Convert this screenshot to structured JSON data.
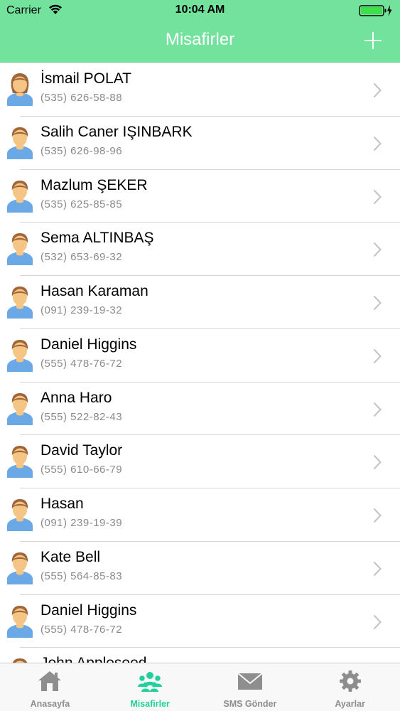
{
  "status_bar": {
    "carrier": "Carrier",
    "time": "10:04 AM",
    "wifi_icon": "wifi-icon",
    "battery_icon": "battery-charging-icon"
  },
  "nav": {
    "title": "Misafirler",
    "add_icon": "plus-icon"
  },
  "colors": {
    "nav_bg": "#72e29d",
    "tab_active": "#22d09a",
    "tab_inactive": "#8e8e8e",
    "phone_text": "#8a8a8a",
    "chevron": "#c2c2c7"
  },
  "guests": [
    {
      "name": "İsmail POLAT",
      "phone": "(535) 626-58-88",
      "avatar": "female-avatar-icon"
    },
    {
      "name": "Salih Caner IŞINBARK",
      "phone": "(535) 626-98-96",
      "avatar": "male-avatar-icon"
    },
    {
      "name": "Mazlum ŞEKER",
      "phone": "(535) 625-85-85",
      "avatar": "male-avatar-icon"
    },
    {
      "name": "Sema ALTINBAŞ",
      "phone": "(532) 653-69-32",
      "avatar": "male-avatar-icon"
    },
    {
      "name": "Hasan Karaman",
      "phone": "(091) 239-19-32",
      "avatar": "male-avatar-icon"
    },
    {
      "name": "Daniel Higgins",
      "phone": "(555) 478-76-72",
      "avatar": "male-avatar-icon"
    },
    {
      "name": "Anna Haro",
      "phone": "(555) 522-82-43",
      "avatar": "male-avatar-icon"
    },
    {
      "name": "David Taylor",
      "phone": "(555) 610-66-79",
      "avatar": "male-avatar-icon"
    },
    {
      "name": "Hasan",
      "phone": "(091) 239-19-39",
      "avatar": "male-avatar-icon"
    },
    {
      "name": "Kate Bell",
      "phone": "(555) 564-85-83",
      "avatar": "male-avatar-icon"
    },
    {
      "name": "Daniel Higgins",
      "phone": "(555) 478-76-72",
      "avatar": "male-avatar-icon"
    },
    {
      "name": "John Appleseed",
      "phone": "",
      "avatar": "male-avatar-icon"
    }
  ],
  "tabs": [
    {
      "label": "Anasayfa",
      "icon": "home-icon",
      "active": false
    },
    {
      "label": "Misafirler",
      "icon": "group-icon",
      "active": true
    },
    {
      "label": "SMS Gönder",
      "icon": "envelope-icon",
      "active": false
    },
    {
      "label": "Ayarlar",
      "icon": "gear-icon",
      "active": false
    }
  ]
}
